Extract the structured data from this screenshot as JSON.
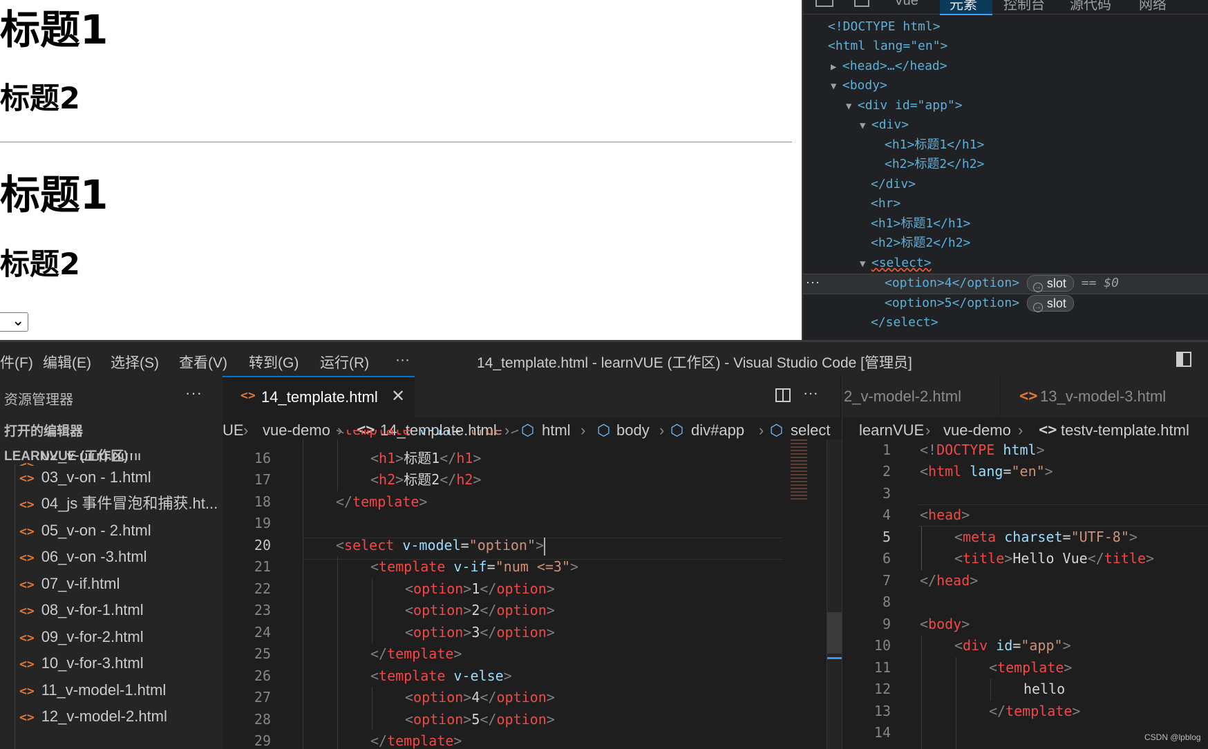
{
  "browser": {
    "heading1_a": "标题1",
    "heading2_a": "标题2",
    "heading1_b": "标题1",
    "heading2_b": "标题2",
    "select_arrow": "⌄"
  },
  "devtools": {
    "tabs": [
      "Vue",
      "元素",
      "控制台",
      "源代码",
      "网络"
    ],
    "active_tab": "元素",
    "dom_lines": [
      "<!DOCTYPE html>",
      "<html lang=\"en\">",
      "<head>…</head>",
      "<body>",
      "<div id=\"app\">",
      "<div>",
      "<h1>标题1</h1>",
      "<h2>标题2</h2>",
      "</div>",
      "<hr>",
      "<h1>标题1</h1>",
      "<h2>标题2</h2>",
      "<select>",
      "<option>4</option>",
      "<option>5</option>",
      "</select>"
    ],
    "slot_badge": "slot",
    "selected_marker": "== $0",
    "ellipsis": "···"
  },
  "vscode": {
    "menus": [
      "件(F)",
      "编辑(E)",
      "选择(S)",
      "查看(V)",
      "转到(G)",
      "运行(R)",
      "···"
    ],
    "window_title": "14_template.html - learnVUE (工作区) - Visual Studio Code [管理员]",
    "sidebar": {
      "header": "资源管理器",
      "more": "···",
      "open_editors": "打开的编辑器",
      "workspace": "LEARNVUE (工作区)",
      "files": [
        "02_v-bind.html",
        "03_v-on - 1.html",
        "04_js 事件冒泡和捕获.ht...",
        "05_v-on - 2.html",
        "06_v-on -3.html",
        "07_v-if.html",
        "08_v-for-1.html",
        "09_v-for-2.html",
        "10_v-for-3.html",
        "11_v-model-1.html",
        "12_v-model-2.html"
      ]
    },
    "editor1": {
      "tab": "14_template.html",
      "close": "✕",
      "breadcrumb": [
        "UE",
        "vue-demo",
        "14_template.html",
        "html",
        "body",
        "div#app",
        "select"
      ],
      "line_numbers": [
        "16",
        "17",
        "18",
        "19",
        "20",
        "21",
        "22",
        "23",
        "24",
        "25",
        "26",
        "27",
        "28",
        "29"
      ],
      "current_line": "20"
    },
    "editor2": {
      "tabs": [
        "2_v-model-2.html",
        "13_v-model-3.html"
      ],
      "breadcrumb": [
        "learnVUE",
        "vue-demo",
        "testv-template.html"
      ],
      "line_numbers": [
        "1",
        "2",
        "3",
        "4",
        "5",
        "6",
        "7",
        "8",
        "9",
        "10",
        "11",
        "12",
        "13",
        "14"
      ],
      "current_line": "5"
    }
  },
  "watermark": "CSDN @lpblog"
}
